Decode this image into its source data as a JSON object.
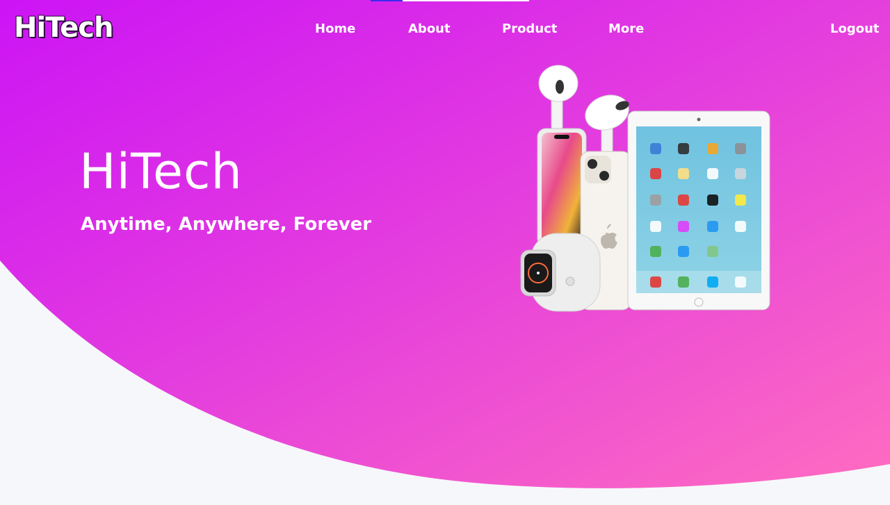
{
  "brand": {
    "logo_text": "HiTech"
  },
  "nav": {
    "items": [
      {
        "label": "Home"
      },
      {
        "label": "About"
      },
      {
        "label": "Product"
      },
      {
        "label": "More"
      }
    ],
    "logout_label": "Logout"
  },
  "hero": {
    "title": "HiTech",
    "tagline": "Anytime, Anywhere, Forever",
    "image_icon": "product-lineup-image"
  },
  "colors": {
    "gradient_start": "#d11cf5",
    "gradient_end": "#ff6ec4",
    "background": "#f6f7fa",
    "text": "#ffffff"
  }
}
